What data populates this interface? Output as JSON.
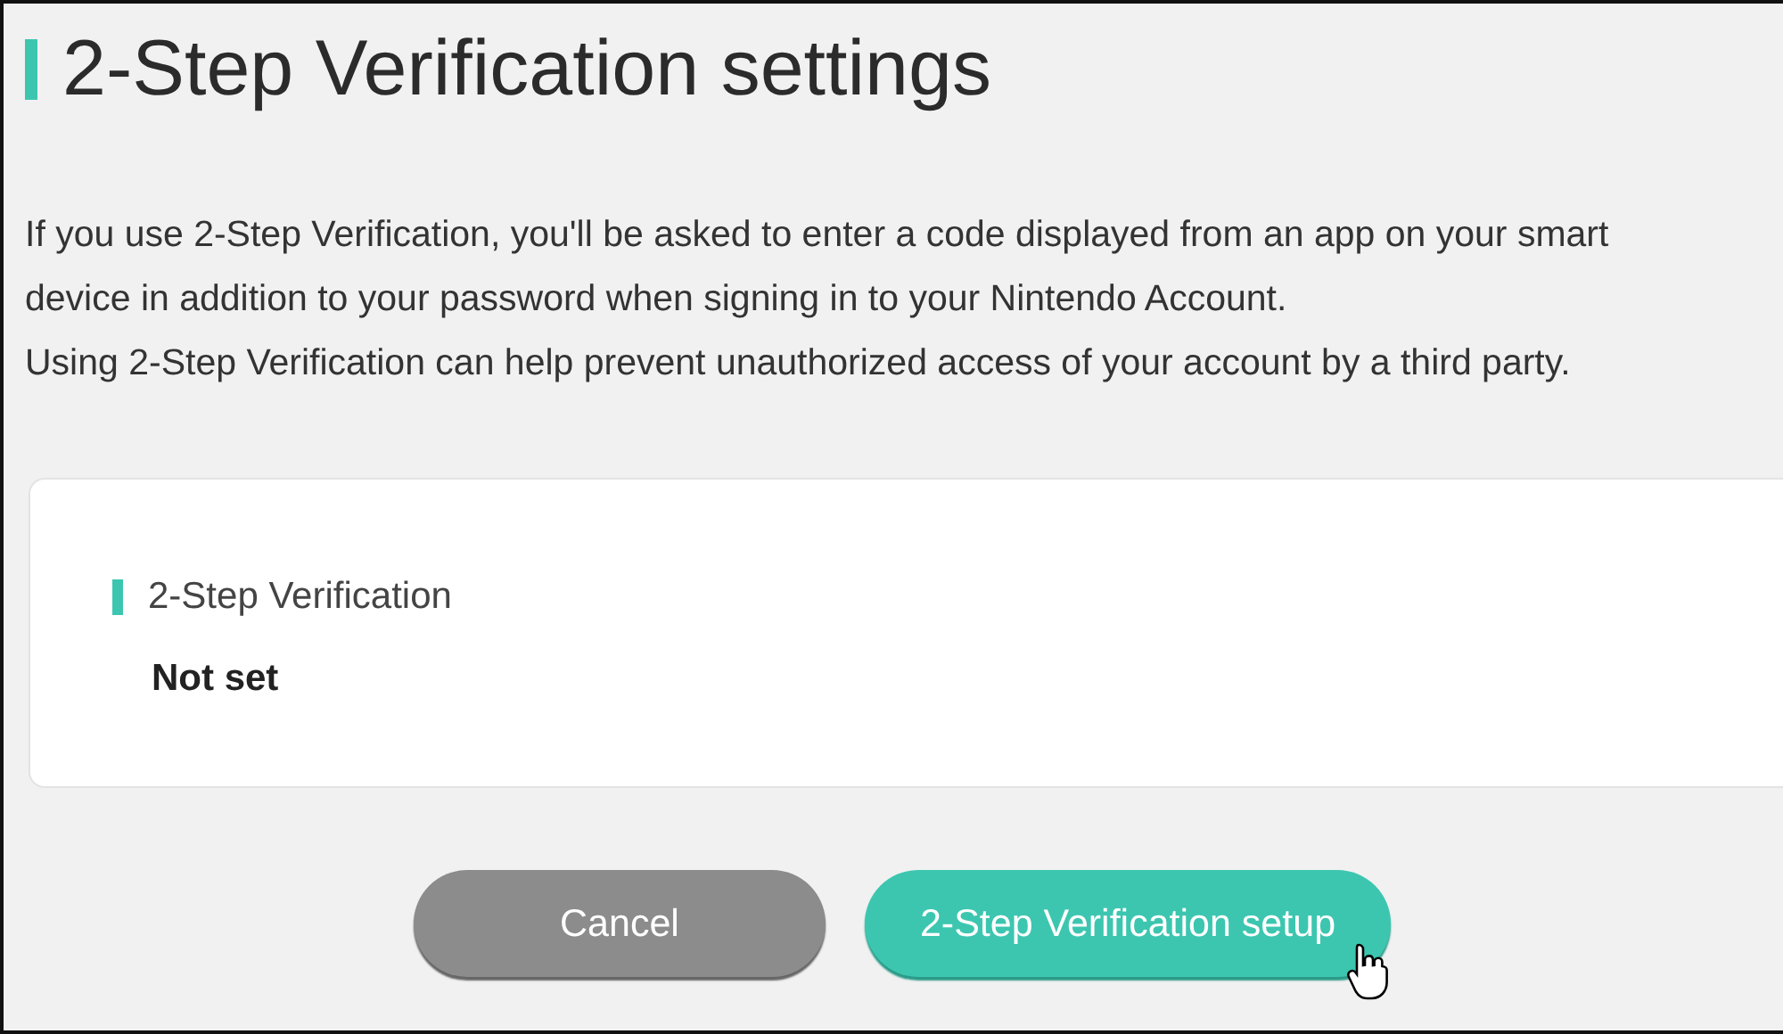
{
  "title": "2-Step Verification settings",
  "description": [
    "If you use 2-Step Verification, you'll be asked to enter a code displayed from an app on your smart device in addition to your password when signing in to your Nintendo Account.",
    "Using 2-Step Verification can help prevent unauthorized access of your account by a third party."
  ],
  "status_card": {
    "label": "2-Step Verification",
    "value": "Not set"
  },
  "buttons": [
    {
      "label": "Cancel",
      "kind": "secondary"
    },
    {
      "label": "2-Step Verification setup",
      "kind": "primary"
    }
  ]
}
